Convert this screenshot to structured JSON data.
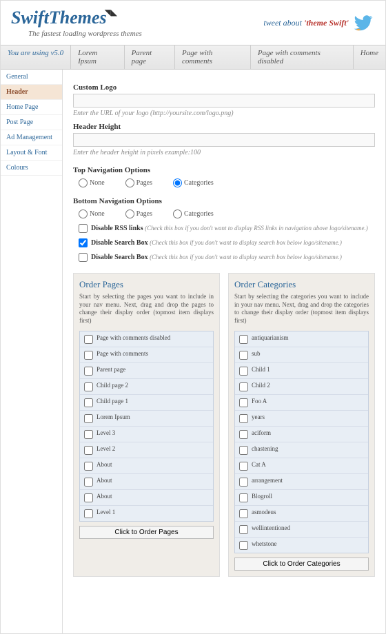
{
  "logo": {
    "main": "SwiftThemes",
    "tagline": "The fastest loading wordpress themes"
  },
  "tweet": {
    "t1": "tweet about ",
    "t2": "'theme Swift'"
  },
  "topbar": {
    "version": "You are using v5.0",
    "items": [
      "Lorem Ipsum",
      "Parent page",
      "Page with comments",
      "Page with comments disabled",
      "Home"
    ]
  },
  "sidebar": [
    "General",
    "Header",
    "Home Page",
    "Post Page",
    "Ad Management",
    "Layout & Font",
    "Colours"
  ],
  "fields": {
    "custom_logo": {
      "label": "Custom Logo",
      "hint": "Enter the URL of your logo (http://yoursite.com/logo.png)"
    },
    "header_height": {
      "label": "Header Height",
      "hint": "Enter the header height in pixels example:100"
    }
  },
  "top_nav": {
    "title": "Top Navigation Options",
    "opts": [
      "None",
      "Pages",
      "Categories"
    ]
  },
  "bot_nav": {
    "title": "Bottom Navigation Options",
    "opts": [
      "None",
      "Pages",
      "Categories"
    ]
  },
  "checks": [
    {
      "lbl": "Disable RSS links",
      "hint": "(Check this box if you don't want to display RSS links in navigation above logo/sitename.)",
      "checked": false
    },
    {
      "lbl": "Disable Search Box",
      "hint": "(Check this box if you don't want to display search box below logo/sitename.)",
      "checked": true
    },
    {
      "lbl": "Disable Search Box",
      "hint": "(Check this box if you don't want to display search box below logo/sitename.)",
      "checked": false
    }
  ],
  "order_pages": {
    "title": "Order Pages",
    "desc": "Start by selecting the pages you want to include in your nav menu. Next, drag and drop the pages to change their display order (topmost item displays first)",
    "items": [
      "Page with comments disabled",
      "Page with comments",
      "Parent page",
      "Child page 2",
      "Child page 1",
      "Lorem Ipsum",
      "Level 3",
      "Level 2",
      "About",
      "About",
      "About",
      "Level 1"
    ],
    "btn": "Click to Order Pages"
  },
  "order_cats": {
    "title": "Order Categories",
    "desc": "Start by selecting the categories you want to include in your nav menu. Next, drag and drop the categories to change their display order (topmost item displays first)",
    "items": [
      "antiquarianism",
      "sub",
      "Child 1",
      "Child 2",
      "Foo A",
      "years",
      "aciform",
      "chastening",
      "Cat A",
      "arrangement",
      "Blogroll",
      "asmodeus",
      "wellintentioned",
      "whetstone"
    ],
    "btn": "Click to Order Categories"
  }
}
